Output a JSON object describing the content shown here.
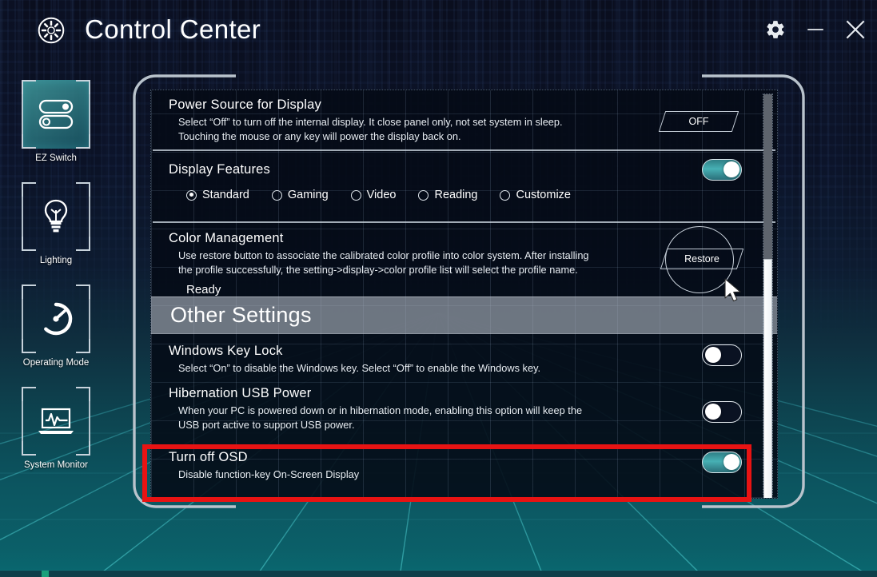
{
  "window": {
    "title": "Control Center",
    "logo_icon": "aperture-icon",
    "controls": [
      {
        "name": "settings-button",
        "icon": "gear-icon",
        "label": "Settings"
      },
      {
        "name": "minimize-button",
        "icon": "minimize-icon",
        "label": "Minimize"
      },
      {
        "name": "close-button",
        "icon": "close-icon",
        "label": "Close"
      }
    ]
  },
  "sidebar": {
    "items": [
      {
        "label": "EZ Switch",
        "icon": "ez-switch-icon",
        "active": true
      },
      {
        "label": "Lighting",
        "icon": "lightbulb-icon",
        "active": false
      },
      {
        "label": "Operating Mode",
        "icon": "gauge-icon",
        "active": false
      },
      {
        "label": "System Monitor",
        "icon": "laptop-pulse-icon",
        "active": false
      }
    ]
  },
  "main": {
    "power_source": {
      "title": "Power Source for Display",
      "desc_line1": "Select “Off” to turn off the internal display. It close panel only, not set system in sleep.",
      "desc_line2": "Touching the mouse or any key will power the display back on.",
      "button_label": "OFF"
    },
    "display_features": {
      "title": "Display Features",
      "toggle_state": "on",
      "options": [
        {
          "label": "Standard",
          "selected": true
        },
        {
          "label": "Gaming",
          "selected": false
        },
        {
          "label": "Video",
          "selected": false
        },
        {
          "label": "Reading",
          "selected": false
        },
        {
          "label": "Customize",
          "selected": false
        }
      ]
    },
    "color_management": {
      "title": "Color Management",
      "desc_line1": "Use restore button to associate the calibrated color profile into color system. After installing",
      "desc_line2": "the profile successfully, the setting->display->color profile list will select the profile name.",
      "status": "Ready",
      "button_label": "Restore"
    },
    "other_settings_banner": "Other Settings",
    "windows_key_lock": {
      "title": "Windows Key Lock",
      "desc": "Select “On” to disable the Windows key. Select “Off” to enable the Windows key.",
      "toggle_state": "off"
    },
    "hibernation_usb_power": {
      "title": "Hibernation USB Power",
      "desc_line1": "When your PC is powered down or in hibernation mode, enabling this option will keep the",
      "desc_line2": "USB port active to support USB power.",
      "toggle_state": "off"
    },
    "turn_off_osd": {
      "title": "Turn off OSD",
      "desc": "Disable function-key On-Screen Display",
      "toggle_state": "on",
      "highlighted": true
    }
  },
  "colors": {
    "accent_teal": "#47b0b4",
    "highlight_red": "#e81313",
    "panel_bg": "#040a16",
    "text_primary": "#ffffff",
    "frame_line": "#b9c3cc"
  },
  "scrollbar": {
    "orientation": "vertical",
    "thumb_position_percent": 40
  },
  "cursor": {
    "icon": "mouse-pointer-icon"
  }
}
